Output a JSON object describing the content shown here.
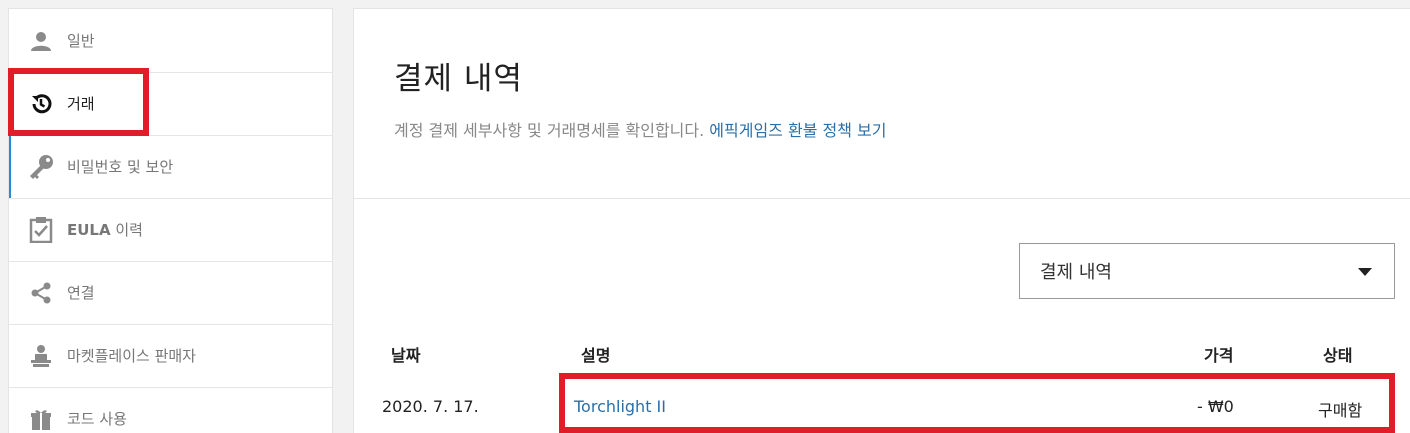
{
  "sidebar": {
    "items": [
      {
        "icon": "person-icon",
        "label": "일반"
      },
      {
        "icon": "history-icon",
        "label": "거래"
      },
      {
        "icon": "key-icon",
        "label": "비밀번호 및 보안"
      },
      {
        "icon": "clipboard-check-icon",
        "label_bold": "EULA",
        "label_rest": " 이력"
      },
      {
        "icon": "share-icon",
        "label": "연결"
      },
      {
        "icon": "seller-icon",
        "label": "마켓플레이스 판매자"
      },
      {
        "icon": "gift-icon",
        "label": "코드 사용"
      }
    ],
    "active_index": 1
  },
  "main": {
    "title": "결제 내역",
    "subtitle": "계정 결제 세부사항 및 거래명세를 확인합니다. ",
    "subtitle_link": "에픽게임즈 환불 정책 보기",
    "filter_select": {
      "value": "결제 내역"
    },
    "table": {
      "headers": {
        "date": "날짜",
        "description": "설명",
        "price": "가격",
        "status": "상태"
      },
      "rows": [
        {
          "date": "2020. 7. 17.",
          "description": "Torchlight II",
          "price": "- ₩0",
          "status": "구매함"
        }
      ]
    }
  },
  "colors": {
    "highlight": "#e21d2a",
    "link": "#2a6fa8",
    "active_bar": "#2a8acd"
  }
}
